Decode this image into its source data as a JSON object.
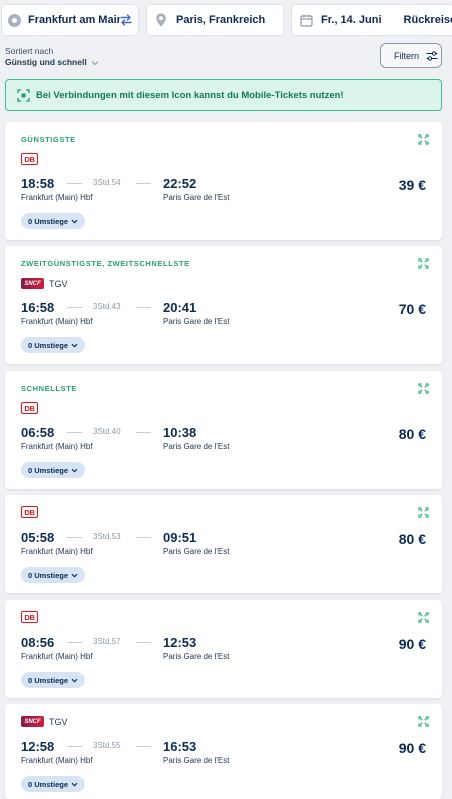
{
  "search": {
    "from": "Frankfurt am Main",
    "to": "Paris, Frankreich",
    "date": "Fr., 14. Juni",
    "return_label": "Rückreise"
  },
  "sort": {
    "label": "Sortiert nach",
    "value": "Günstig und schnell"
  },
  "filter_label": "Filtern",
  "banner_text": "Bei Verbindungen mit diesem Icon kannst du Mobile-Tickets nutzen!",
  "colors": {
    "accent_green": "#25a26e",
    "navy": "#0d2a52",
    "db_red": "#e2161e",
    "pill_bg": "#d6e4f5"
  },
  "results": [
    {
      "badge": "GÜNSTIGSTE",
      "operator": "DB",
      "operator_label": "",
      "dep_time": "18:58",
      "duration": "3Std.54",
      "arr_time": "22:52",
      "dep_station": "Frankfurt (Main) Hbf",
      "arr_station": "Paris Gare de l'Est",
      "price": "39 €",
      "changes": "0 Umstiege",
      "icon": "expand-icon"
    },
    {
      "badge": "ZWEITGÜNSTIGSTE, ZWEITSCHNELLSTE",
      "operator": "SNCF",
      "operator_label": "TGV",
      "dep_time": "16:58",
      "duration": "3Std.43",
      "arr_time": "20:41",
      "dep_station": "Frankfurt (Main) Hbf",
      "arr_station": "Paris Gare de l'Est",
      "price": "70 €",
      "changes": "0 Umstiege",
      "icon": "expand-icon"
    },
    {
      "badge": "SCHNELLSTE",
      "operator": "DB",
      "operator_label": "",
      "dep_time": "06:58",
      "duration": "3Std.40",
      "arr_time": "10:38",
      "dep_station": "Frankfurt (Main) Hbf",
      "arr_station": "Paris Gare de l'Est",
      "price": "80 €",
      "changes": "0 Umstiege",
      "icon": "expand-icon"
    },
    {
      "badge": "",
      "operator": "DB",
      "operator_label": "",
      "dep_time": "05:58",
      "duration": "3Std.53",
      "arr_time": "09:51",
      "dep_station": "Frankfurt (Main) Hbf",
      "arr_station": "Paris Gare de l'Est",
      "price": "80 €",
      "changes": "0 Umstiege",
      "icon": "expand-icon"
    },
    {
      "badge": "",
      "operator": "DB",
      "operator_label": "",
      "dep_time": "08:56",
      "duration": "3Std.57",
      "arr_time": "12:53",
      "dep_station": "Frankfurt (Main) Hbf",
      "arr_station": "Paris Gare de l'Est",
      "price": "90 €",
      "changes": "0 Umstiege",
      "icon": "expand-icon"
    },
    {
      "badge": "",
      "operator": "SNCF",
      "operator_label": "TGV",
      "dep_time": "12:58",
      "duration": "3Std.55",
      "arr_time": "16:53",
      "dep_station": "Frankfurt (Main) Hbf",
      "arr_station": "Paris Gare de l'Est",
      "price": "90 €",
      "changes": "0 Umstiege",
      "icon": "expand-icon"
    }
  ]
}
